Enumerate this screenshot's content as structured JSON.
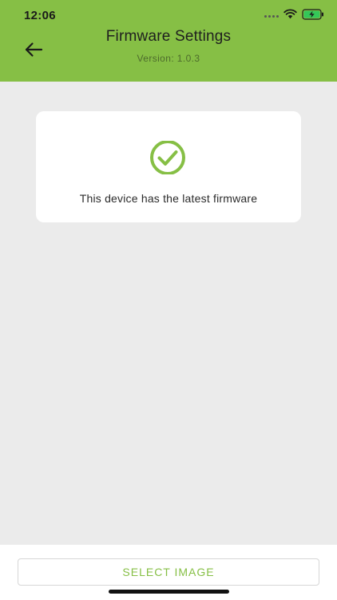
{
  "status_bar": {
    "time": "12:06",
    "icons": [
      "signal-dots-icon",
      "wifi-icon",
      "battery-charging-icon"
    ]
  },
  "header": {
    "title": "Firmware Settings",
    "subtitle": "Version: 1.0.3",
    "back_icon": "arrow-left-icon",
    "background_color": "#86bf45"
  },
  "card": {
    "status_icon": "check-circle-icon",
    "message": "This device has the latest firmware",
    "icon_color": "#86bf45"
  },
  "footer": {
    "select_button_label": "SELECT IMAGE",
    "accent_color": "#86bf45"
  }
}
